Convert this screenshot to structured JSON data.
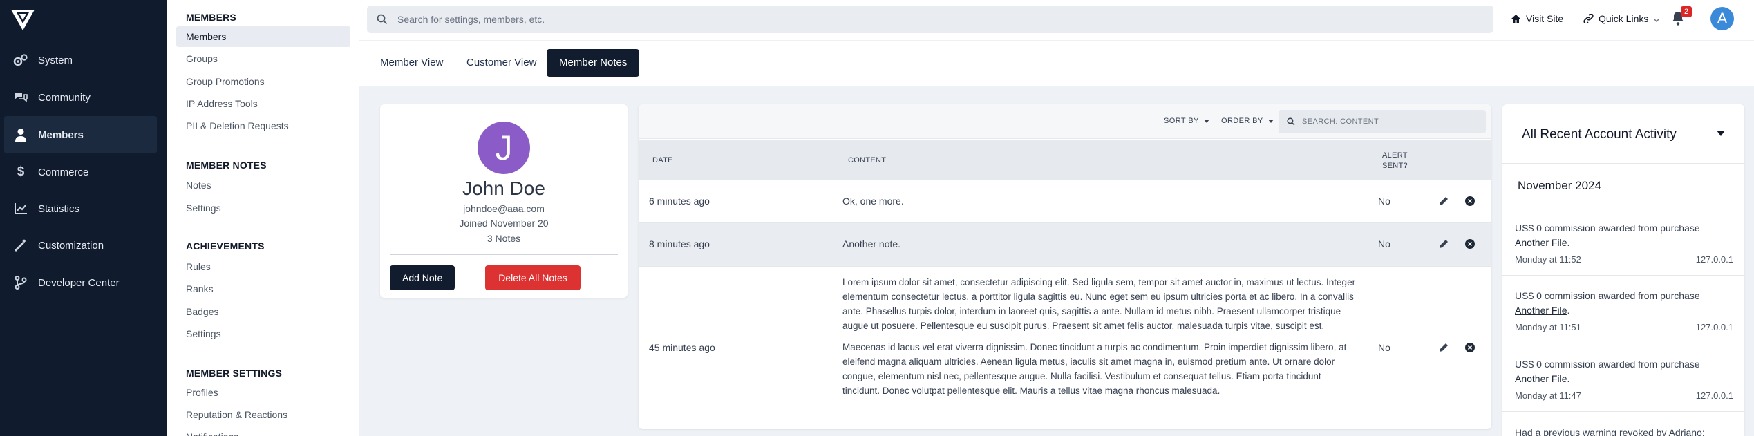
{
  "nav": {
    "items": [
      {
        "label": "System",
        "icon": "gears-icon"
      },
      {
        "label": "Community",
        "icon": "chat-icon"
      },
      {
        "label": "Members",
        "icon": "user-icon"
      },
      {
        "label": "Commerce",
        "icon": "dollar-icon"
      },
      {
        "label": "Statistics",
        "icon": "chart-icon"
      },
      {
        "label": "Customization",
        "icon": "magic-icon"
      },
      {
        "label": "Developer Center",
        "icon": "branch-icon"
      }
    ],
    "active": "Members"
  },
  "submenu": {
    "sections": [
      {
        "heading": "MEMBERS",
        "items": [
          "Members",
          "Groups",
          "Group Promotions",
          "IP Address Tools",
          "PII & Deletion Requests"
        ]
      },
      {
        "heading": "MEMBER NOTES",
        "items": [
          "Notes",
          "Settings"
        ]
      },
      {
        "heading": "ACHIEVEMENTS",
        "items": [
          "Rules",
          "Ranks",
          "Badges",
          "Settings"
        ]
      },
      {
        "heading": "MEMBER SETTINGS",
        "items": [
          "Profiles",
          "Reputation & Reactions",
          "Notifications"
        ]
      }
    ],
    "active": "Members"
  },
  "topbar": {
    "search_placeholder": "Search for settings, members, etc.",
    "visit_site": "Visit Site",
    "quick_links": "Quick Links",
    "notification_count": "2",
    "avatar_letter": "A"
  },
  "tabs": [
    "Member View",
    "Customer View",
    "Member Notes"
  ],
  "active_tab": "Member Notes",
  "profile": {
    "initial": "J",
    "name": "John Doe",
    "email": "johndoe@aaa.com",
    "joined": "Joined November 20",
    "notes_count": "3 Notes",
    "add_note": "Add Note",
    "delete_all": "Delete All Notes"
  },
  "notes_table": {
    "sort_by": "SORT BY",
    "order_by": "ORDER BY",
    "search_placeholder": "SEARCH: CONTENT",
    "columns": {
      "date": "DATE",
      "content": "CONTENT",
      "alert": "ALERT SENT?"
    },
    "rows": [
      {
        "date": "6 minutes ago",
        "content": [
          "Ok, one more."
        ],
        "alert": "No"
      },
      {
        "date": "8 minutes ago",
        "content": [
          "Another note."
        ],
        "alert": "No"
      },
      {
        "date": "45 minutes ago",
        "content": [
          "Lorem ipsum dolor sit amet, consectetur adipiscing elit. Sed ligula sem, tempor sit amet auctor in, maximus ut lectus. Integer elementum consectetur lectus, a porttitor ligula sagittis eu. Nunc eget sem eu ipsum ultricies porta et ac libero. In a convallis ante. Phasellus turpis dolor, interdum in laoreet quis, sagittis a ante. Nullam id metus nibh. Praesent ullamcorper tristique augue ut posuere. Pellentesque eu suscipit purus. Praesent sit amet felis auctor, malesuada turpis vitae, suscipit est.",
          "Maecenas id lacus vel erat viverra dignissim. Donec tincidunt a turpis ac condimentum. Proin imperdiet dignissim libero, at eleifend magna aliquam ultricies. Aenean ligula metus, iaculis sit amet magna in, euismod pretium ante. Ut ornare dolor congue, elementum nisl nec, pellentesque augue. Nulla facilisi. Vestibulum et consequat tellus. Etiam porta tincidunt tincidunt. Donec volutpat pellentesque elit. Mauris a tellus vitae magna rhoncus malesuada."
        ],
        "alert": "No"
      }
    ]
  },
  "activity": {
    "title": "All Recent Account Activity",
    "month": "November 2024",
    "entries": [
      {
        "text": "US$ 0 commission awarded from purchase",
        "link": "Another File",
        "time": "Monday at 11:52",
        "ip": "127.0.0.1"
      },
      {
        "text": "US$ 0 commission awarded from purchase",
        "link": "Another File",
        "time": "Monday at 11:51",
        "ip": "127.0.0.1"
      },
      {
        "text": "US$ 0 commission awarded from purchase",
        "link": "Another File",
        "time": "Monday at 11:47",
        "ip": "127.0.0.1"
      },
      {
        "text": "Had a previous warning revoked by Adriano:"
      }
    ]
  },
  "colors": {
    "nav_bg": "#101c2e",
    "accent_dark": "#111c2f",
    "danger": "#dc3232",
    "avatar_purple": "#8b5cc7",
    "avatar_blue": "#3b8ad9"
  }
}
